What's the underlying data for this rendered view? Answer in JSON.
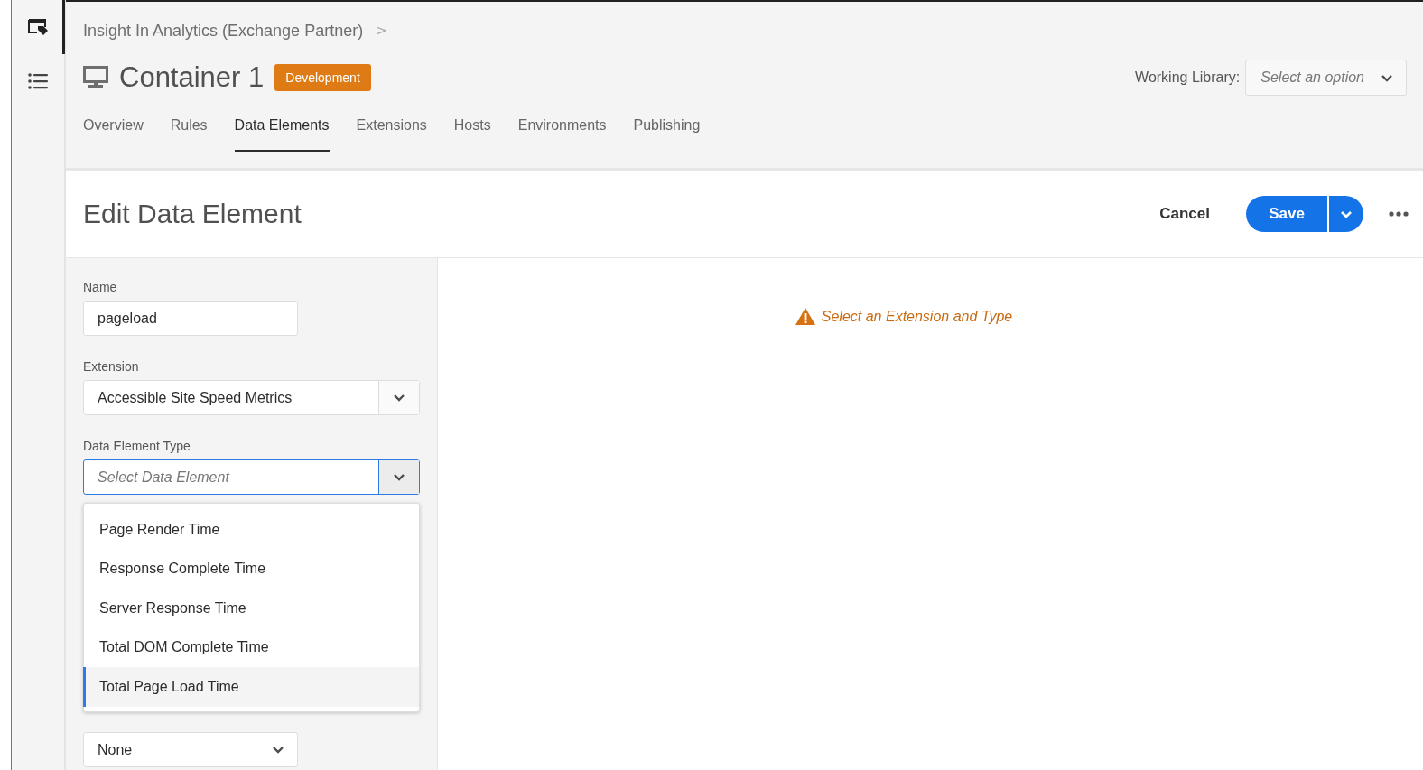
{
  "rail": {
    "items": [
      {
        "kind": "property",
        "selected": true
      },
      {
        "kind": "list",
        "selected": false
      }
    ]
  },
  "breadcrumb": {
    "text": "Insight In Analytics (Exchange Partner)",
    "separator": ">"
  },
  "container": {
    "title": "Container 1",
    "badge": "Development"
  },
  "working_library": {
    "label": "Working Library:",
    "placeholder": "Select an option"
  },
  "tabs": [
    {
      "label": "Overview",
      "selected": false
    },
    {
      "label": "Rules",
      "selected": false
    },
    {
      "label": "Data Elements",
      "selected": true
    },
    {
      "label": "Extensions",
      "selected": false
    },
    {
      "label": "Hosts",
      "selected": false
    },
    {
      "label": "Environments",
      "selected": false
    },
    {
      "label": "Publishing",
      "selected": false
    }
  ],
  "editor": {
    "title": "Edit Data Element",
    "cancel": "Cancel",
    "save": "Save"
  },
  "form": {
    "name": {
      "label": "Name",
      "value": "pageload"
    },
    "extension": {
      "label": "Extension",
      "value": "Accessible Site Speed Metrics"
    },
    "type": {
      "label": "Data Element Type",
      "placeholder": "Select Data Element",
      "focused": true
    },
    "menu": [
      {
        "label": "Page Render Time",
        "selected": false
      },
      {
        "label": "Response Complete Time",
        "selected": false
      },
      {
        "label": "Server Response Time",
        "selected": false
      },
      {
        "label": "Total DOM Complete Time",
        "selected": false
      },
      {
        "label": "Total Page Load Time",
        "selected": true
      }
    ],
    "lower_select": {
      "value": "None"
    }
  },
  "warning": {
    "text": "Select an Extension and Type"
  }
}
